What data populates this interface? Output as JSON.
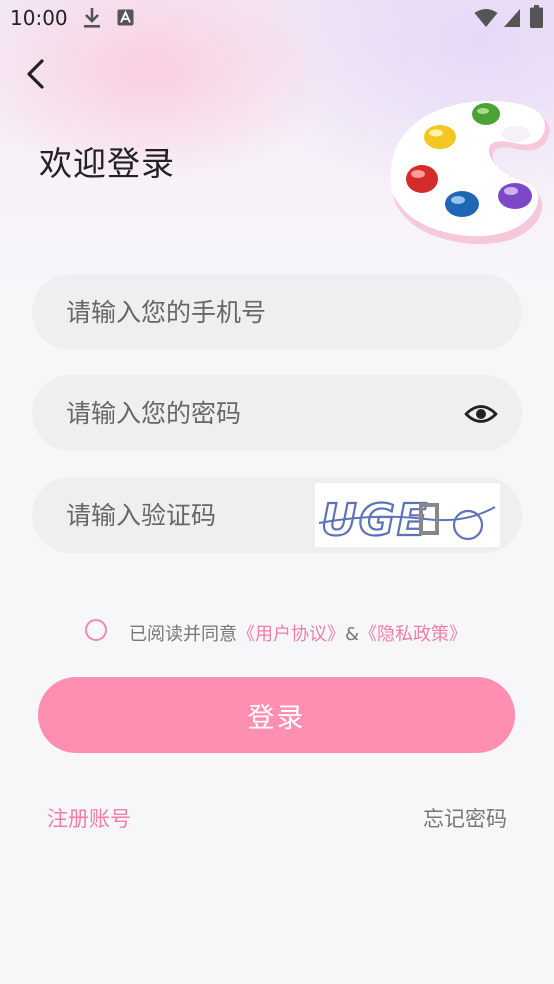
{
  "status_bar": {
    "time": "10:00",
    "icons": [
      "download-icon",
      "font-a-icon",
      "wifi-icon",
      "signal-icon",
      "battery-icon"
    ]
  },
  "header": {
    "back_icon": "chevron-left-icon",
    "title": "欢迎登录"
  },
  "form": {
    "phone_placeholder": "请输入您的手机号",
    "password_placeholder": "请输入您的密码",
    "code_placeholder": "请输入验证码",
    "captcha_text": "UGE"
  },
  "agreement": {
    "prefix": "已阅读并同意",
    "user_agreement": "《用户协议》",
    "connector": "&",
    "privacy_policy": "《隐私政策》",
    "checked": false
  },
  "buttons": {
    "login": "登录",
    "register": "注册账号",
    "forgot": "忘记密码"
  },
  "colors": {
    "accent": "#ff8fb1",
    "link": "#f07fa5",
    "field_bg": "#efeff1"
  }
}
